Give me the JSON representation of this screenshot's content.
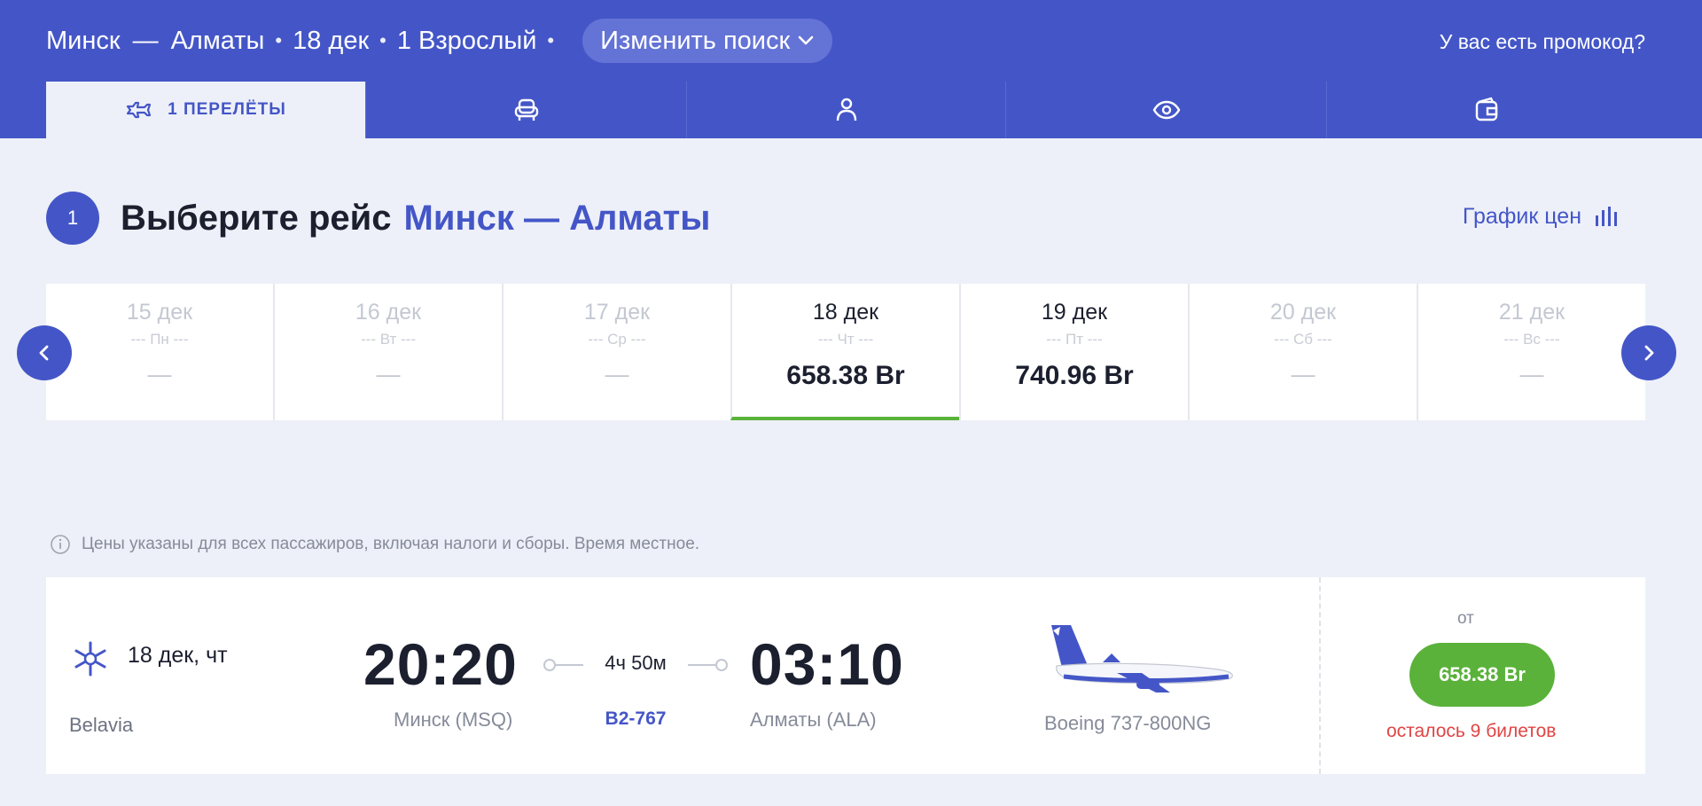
{
  "header": {
    "from": "Минск",
    "dash": "—",
    "to": "Алматы",
    "bullet": "•",
    "date": "18 дек",
    "passengers": "1 Взрослый",
    "change_search_label": "Изменить поиск",
    "promo_label": "У вас есть промокод?"
  },
  "tabs": [
    {
      "label": "1 ПЕРЕЛЁТЫ",
      "icon": "plane-icon",
      "active": true
    },
    {
      "label": "",
      "icon": "seat-icon"
    },
    {
      "label": "",
      "icon": "passenger-icon"
    },
    {
      "label": "",
      "icon": "eye-icon"
    },
    {
      "label": "",
      "icon": "wallet-icon"
    }
  ],
  "step": {
    "number": "1",
    "title": "Выберите рейс",
    "route": "Минск — Алматы",
    "price_graph_label": "График цен"
  },
  "dates": [
    {
      "date": "15 дек",
      "weekday": "--- Пн ---",
      "price": "—"
    },
    {
      "date": "16 дек",
      "weekday": "--- Вт ---",
      "price": "—"
    },
    {
      "date": "17 дек",
      "weekday": "--- Ср ---",
      "price": "—"
    },
    {
      "date": "18 дек",
      "weekday": "--- Чт ---",
      "price": "658.38 Br",
      "selected": true
    },
    {
      "date": "19 дек",
      "weekday": "--- Пт ---",
      "price": "740.96 Br"
    },
    {
      "date": "20 дек",
      "weekday": "--- Сб ---",
      "price": "—"
    },
    {
      "date": "21 дек",
      "weekday": "--- Вс ---",
      "price": "—"
    }
  ],
  "info_text": "Цены указаны для всех пассажиров, включая налоги и сборы. Время местное.",
  "flight": {
    "date": "18 дек, чт",
    "airline": "Belavia",
    "dep_time": "20:20",
    "dep_city": "Минск (MSQ)",
    "duration": "4ч 50м",
    "flight_no": "B2-767",
    "arr_time": "03:10",
    "arr_city": "Алматы (ALA)",
    "aircraft": "Boeing 737-800NG",
    "from_label": "от",
    "price": "658.38 Br",
    "tickets_left": "осталось 9 билетов"
  },
  "colors": {
    "brand": "#4456c7",
    "background": "#edf0f8",
    "price_green": "#5ab23a",
    "warning_red": "#e04444"
  }
}
